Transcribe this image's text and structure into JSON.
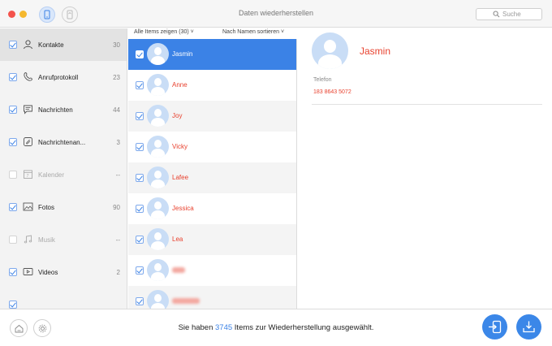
{
  "window": {
    "title": "Daten wiederherstellen",
    "search_placeholder": "Suche"
  },
  "sidebar": {
    "items": [
      {
        "label": "Kontakte",
        "count": "30",
        "checked": true,
        "icon": "person-icon"
      },
      {
        "label": "Anrufprotokoll",
        "count": "23",
        "checked": true,
        "icon": "phone-icon"
      },
      {
        "label": "Nachrichten",
        "count": "44",
        "checked": true,
        "icon": "message-icon"
      },
      {
        "label": "Nachrichtenan...",
        "count": "3",
        "checked": true,
        "icon": "paperclip-icon"
      },
      {
        "label": "Kalender",
        "count": "--",
        "checked": false,
        "icon": "calendar-icon"
      },
      {
        "label": "Fotos",
        "count": "90",
        "checked": true,
        "icon": "photo-icon"
      },
      {
        "label": "Musik",
        "count": "--",
        "checked": false,
        "icon": "music-icon"
      },
      {
        "label": "Videos",
        "count": "2",
        "checked": true,
        "icon": "video-icon"
      }
    ]
  },
  "list": {
    "filter_label": "Alle Items zeigen (30)",
    "sort_label": "Nach Namen sortieren",
    "contacts": [
      "Jasmin",
      "Anne",
      "Joy",
      "Vicky",
      "Lafee",
      "Jessica",
      "Lea",
      "",
      ""
    ]
  },
  "detail": {
    "name": "Jasmin",
    "field_label": "Telefon",
    "field_value": "183 8643 5072"
  },
  "footer": {
    "status_prefix": "Sie haben",
    "status_count": "3745",
    "status_suffix": "Items zur Wiederherstellung ausgewählt."
  },
  "colors": {
    "accent": "#3b82e6",
    "name_red": "#e8412e"
  }
}
